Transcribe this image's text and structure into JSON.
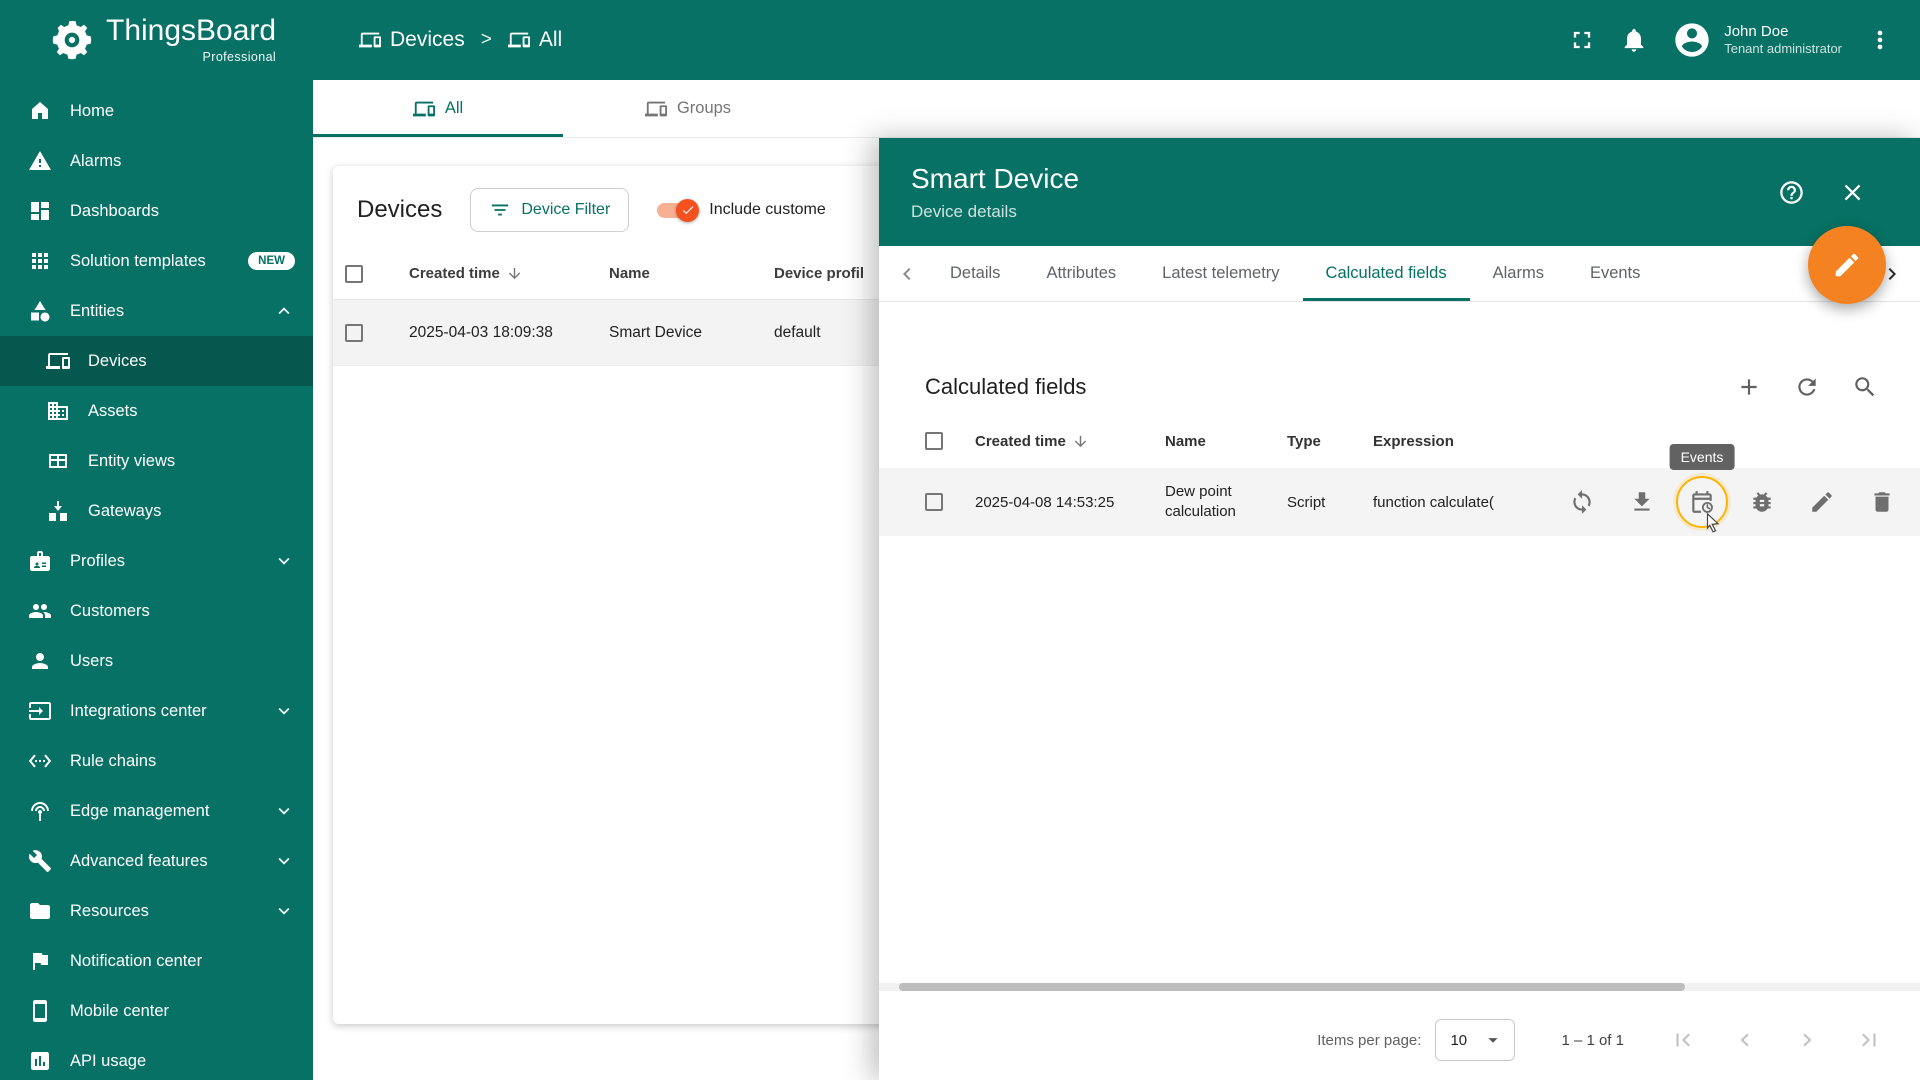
{
  "topbar": {
    "brand": "ThingsBoard",
    "brand_sub": "Professional",
    "breadcrumb": {
      "root": "Devices",
      "separator": ">",
      "current": "All"
    },
    "user_name": "John Doe",
    "user_role": "Tenant administrator"
  },
  "sidebar": {
    "items": [
      {
        "label": "Home"
      },
      {
        "label": "Alarms"
      },
      {
        "label": "Dashboards"
      },
      {
        "label": "Solution templates",
        "badge": "NEW"
      },
      {
        "label": "Entities"
      },
      {
        "label": "Devices"
      },
      {
        "label": "Assets"
      },
      {
        "label": "Entity views"
      },
      {
        "label": "Gateways"
      },
      {
        "label": "Profiles"
      },
      {
        "label": "Customers"
      },
      {
        "label": "Users"
      },
      {
        "label": "Integrations center"
      },
      {
        "label": "Rule chains"
      },
      {
        "label": "Edge management"
      },
      {
        "label": "Advanced features"
      },
      {
        "label": "Resources"
      },
      {
        "label": "Notification center"
      },
      {
        "label": "Mobile center"
      },
      {
        "label": "API usage"
      }
    ]
  },
  "main": {
    "tabs": [
      {
        "label": "All"
      },
      {
        "label": "Groups"
      }
    ],
    "panel": {
      "title": "Devices",
      "filter_button": "Device Filter",
      "toggle_label": "Include custome",
      "columns": {
        "created": "Created time",
        "name": "Name",
        "profile": "Device profil"
      },
      "rows": [
        {
          "created_time": "2025-04-03 18:09:38",
          "name": "Smart Device",
          "profile": "default"
        }
      ]
    }
  },
  "drawer": {
    "title": "Smart Device",
    "subtitle": "Device details",
    "tabs": [
      {
        "label": "Details"
      },
      {
        "label": "Attributes"
      },
      {
        "label": "Latest telemetry"
      },
      {
        "label": "Calculated fields"
      },
      {
        "label": "Alarms"
      },
      {
        "label": "Events"
      }
    ],
    "section": {
      "title": "Calculated fields",
      "columns": {
        "created": "Created time",
        "name": "Name",
        "type": "Type",
        "expression": "Expression"
      },
      "rows": [
        {
          "created_time": "2025-04-08 14:53:25",
          "name": "Dew point calculation",
          "type": "Script",
          "expression": "function calculate("
        }
      ],
      "tooltip": "Events"
    },
    "footer": {
      "items_per_page_label": "Items per page:",
      "items_per_page_value": "10",
      "range_label": "1 – 1 of 1"
    }
  },
  "colors": {
    "primary": "#067164",
    "accent_fab": "#f58220",
    "toggle_checked": "#f4511e",
    "highlight_ring": "#ffb300"
  }
}
